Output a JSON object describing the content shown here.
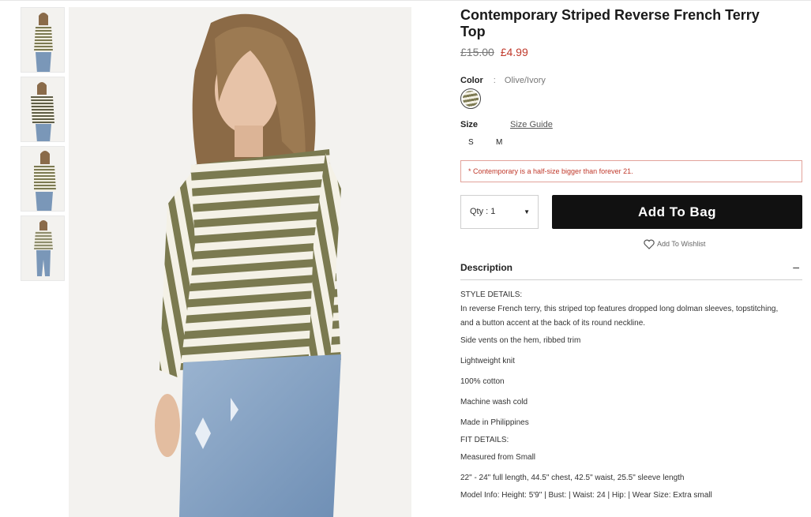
{
  "product": {
    "title": "Contemporary Striped Reverse French Terry Top",
    "price_old": "£15.00",
    "price_new": "£4.99"
  },
  "color": {
    "label": "Color",
    "separator": ":",
    "value": "Olive/Ivory"
  },
  "size": {
    "label": "Size",
    "guide": "Size Guide",
    "options": [
      "S",
      "M"
    ]
  },
  "notice": "* Contemporary is a half-size bigger than forever 21.",
  "qty": {
    "label": "Qty : 1"
  },
  "add_to_bag": "Add To Bag",
  "wishlist": "Add To Wishlist",
  "description": {
    "heading": "Description",
    "toggle": "–",
    "style_heading": "STYLE DETAILS:",
    "style_text": "In reverse French terry, this striped top features dropped long dolman sleeves, topstitching, and a button accent at the back of its round neckline.",
    "details": [
      "Side vents on the hem, ribbed trim",
      "Lightweight knit",
      "100% cotton",
      "Machine wash cold",
      "Made in Philippines"
    ],
    "fit_heading": "FIT DETAILS:",
    "fit": [
      "Measured from Small",
      "22\" - 24\" full length, 44.5\" chest, 42.5\" waist, 25.5\" sleeve length",
      "Model Info: Height: 5'9\" | Bust: | Waist: 24 | Hip: | Wear Size: Extra small"
    ]
  }
}
